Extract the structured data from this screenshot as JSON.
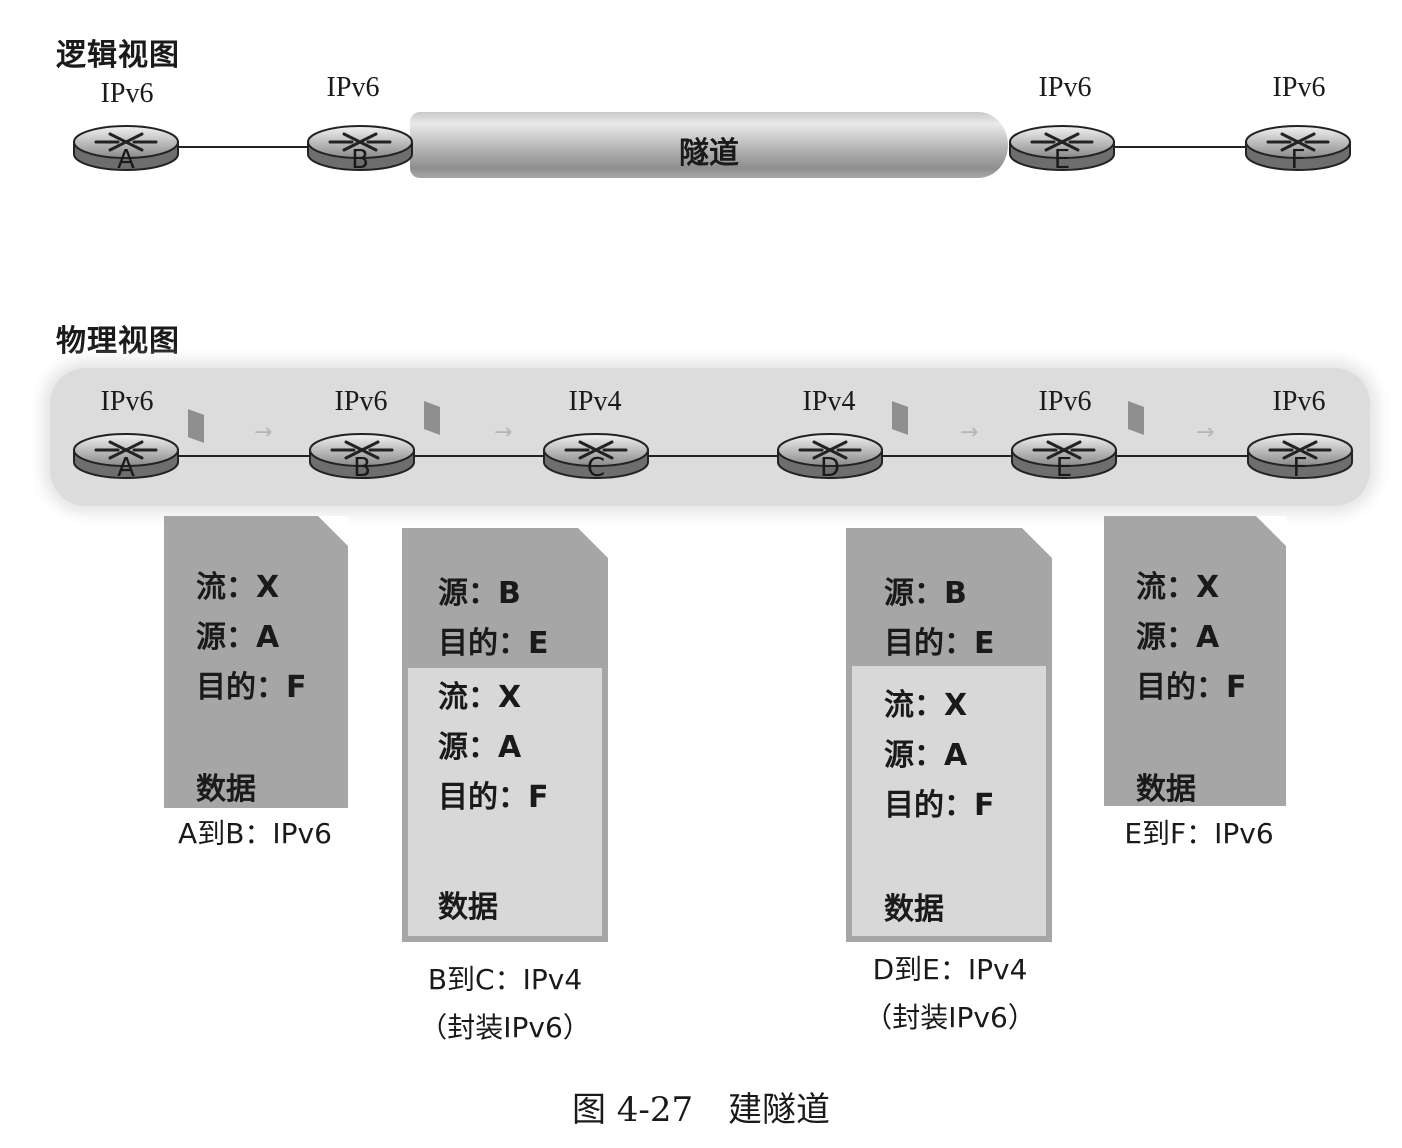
{
  "logical_view": {
    "title": "逻辑视图",
    "routers": [
      {
        "label": "A",
        "protocol": "IPv6"
      },
      {
        "label": "B",
        "protocol": "IPv6"
      },
      {
        "label": "E",
        "protocol": "IPv6"
      },
      {
        "label": "F",
        "protocol": "IPv6"
      }
    ],
    "tunnel_label": "隧道"
  },
  "physical_view": {
    "title": "物理视图",
    "routers": [
      {
        "label": "A",
        "protocol": "IPv6"
      },
      {
        "label": "B",
        "protocol": "IPv6"
      },
      {
        "label": "C",
        "protocol": "IPv4"
      },
      {
        "label": "D",
        "protocol": "IPv4"
      },
      {
        "label": "E",
        "protocol": "IPv6"
      },
      {
        "label": "F",
        "protocol": "IPv6"
      }
    ]
  },
  "packets": [
    {
      "outer": [],
      "inner": [
        "流：X",
        "源：A",
        "目的：F"
      ],
      "data": "数据",
      "caption": [
        "A到B：IPv6"
      ]
    },
    {
      "outer": [
        "源：B",
        "目的：E"
      ],
      "inner": [
        "流：X",
        "源：A",
        "目的：F"
      ],
      "data": "数据",
      "caption": [
        "B到C：IPv4",
        "（封装IPv6）"
      ]
    },
    {
      "outer": [
        "源：B",
        "目的：E"
      ],
      "inner": [
        "流：X",
        "源：A",
        "目的：F"
      ],
      "data": "数据",
      "caption": [
        "D到E：IPv4",
        "（封装IPv6）"
      ]
    },
    {
      "outer": [],
      "inner": [
        "流：X",
        "源：A",
        "目的：F"
      ],
      "data": "数据",
      "caption": [
        "E到F：IPv6"
      ]
    }
  ],
  "figure": {
    "number": "图 4-27",
    "title": "建隧道"
  }
}
